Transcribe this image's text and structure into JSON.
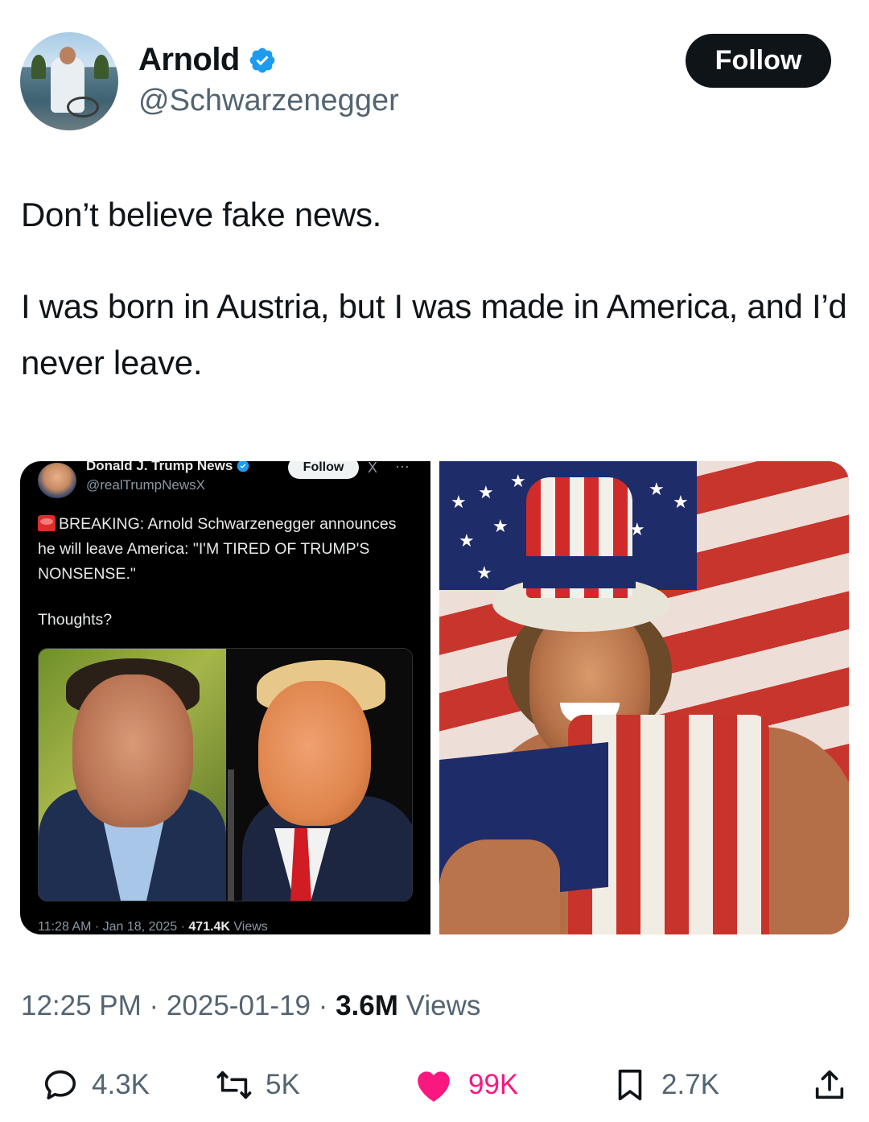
{
  "author": {
    "name": "Arnold",
    "handle": "@Schwarzenegger",
    "verified": true,
    "follow_label": "Follow"
  },
  "tweet": {
    "paragraphs": [
      "Don’t believe fake news.",
      "I was born in Austria, but I was made in America, and I’d never leave."
    ]
  },
  "embedded_post": {
    "name": "Donald J. Trump News",
    "handle": "@realTrumpNewsX",
    "follow_label": "Follow",
    "x_glyph": "X",
    "more_glyph": "···",
    "text": "BREAKING: Arnold Schwarzenegger announces he will leave America: \"I'M  TIRED OF TRUMP'S NONSENSE.\"",
    "thoughts": "Thoughts?",
    "meta_time": "11:28 AM · Jan 18, 2025 · ",
    "meta_views": "471.4K",
    "meta_views_label": " Views"
  },
  "meta": {
    "time": "12:25 PM",
    "sep": " · ",
    "date": "2025-01-19",
    "views_count": "3.6M",
    "views_label": " Views"
  },
  "actions": {
    "replies": "4.3K",
    "reposts": "5K",
    "likes": "99K",
    "bookmarks": "2.7K"
  },
  "colors": {
    "follow_bg": "#0f1419",
    "verified": "#1d9bf0",
    "like": "#f91880",
    "secondary_text": "#536471"
  },
  "icons": [
    "verified-badge-icon",
    "reply-icon",
    "repost-icon",
    "like-heart-icon",
    "bookmark-icon",
    "share-icon"
  ]
}
